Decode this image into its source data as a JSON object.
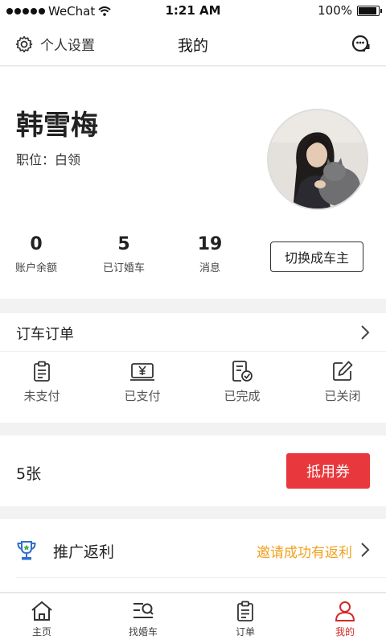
{
  "status_bar": {
    "carrier": "WeChat",
    "time": "1:21 AM",
    "battery": "100%"
  },
  "nav": {
    "settings_label": "个人设置",
    "title": "我的"
  },
  "profile": {
    "name": "韩雪梅",
    "position": "职位：白领"
  },
  "stats": [
    {
      "value": "0",
      "label": "账户余额"
    },
    {
      "value": "5",
      "label": "已订婚车"
    },
    {
      "value": "19",
      "label": "消息"
    }
  ],
  "switch_button": "切换成车主",
  "orders": {
    "title": "订车订单",
    "items": [
      {
        "label": "未支付",
        "icon": "clipboard-icon"
      },
      {
        "label": "已支付",
        "icon": "yen-icon"
      },
      {
        "label": "已完成",
        "icon": "completed-icon"
      },
      {
        "label": "已关闭",
        "icon": "edit-icon"
      }
    ]
  },
  "coupon": {
    "count": "5张",
    "button": "抵用券"
  },
  "promo": {
    "label": "推广返利",
    "invite": "邀请成功有返利"
  },
  "tabs": [
    {
      "label": "主页",
      "icon": "home-icon"
    },
    {
      "label": "找婚车",
      "icon": "search-list-icon"
    },
    {
      "label": "订单",
      "icon": "clipboard-icon"
    },
    {
      "label": "我的",
      "icon": "person-icon"
    }
  ],
  "colors": {
    "accent_red": "#e8383d",
    "tab_active": "#d12b2b",
    "invite_orange": "#f0a11e",
    "trophy_blue": "#2f6fd1"
  }
}
